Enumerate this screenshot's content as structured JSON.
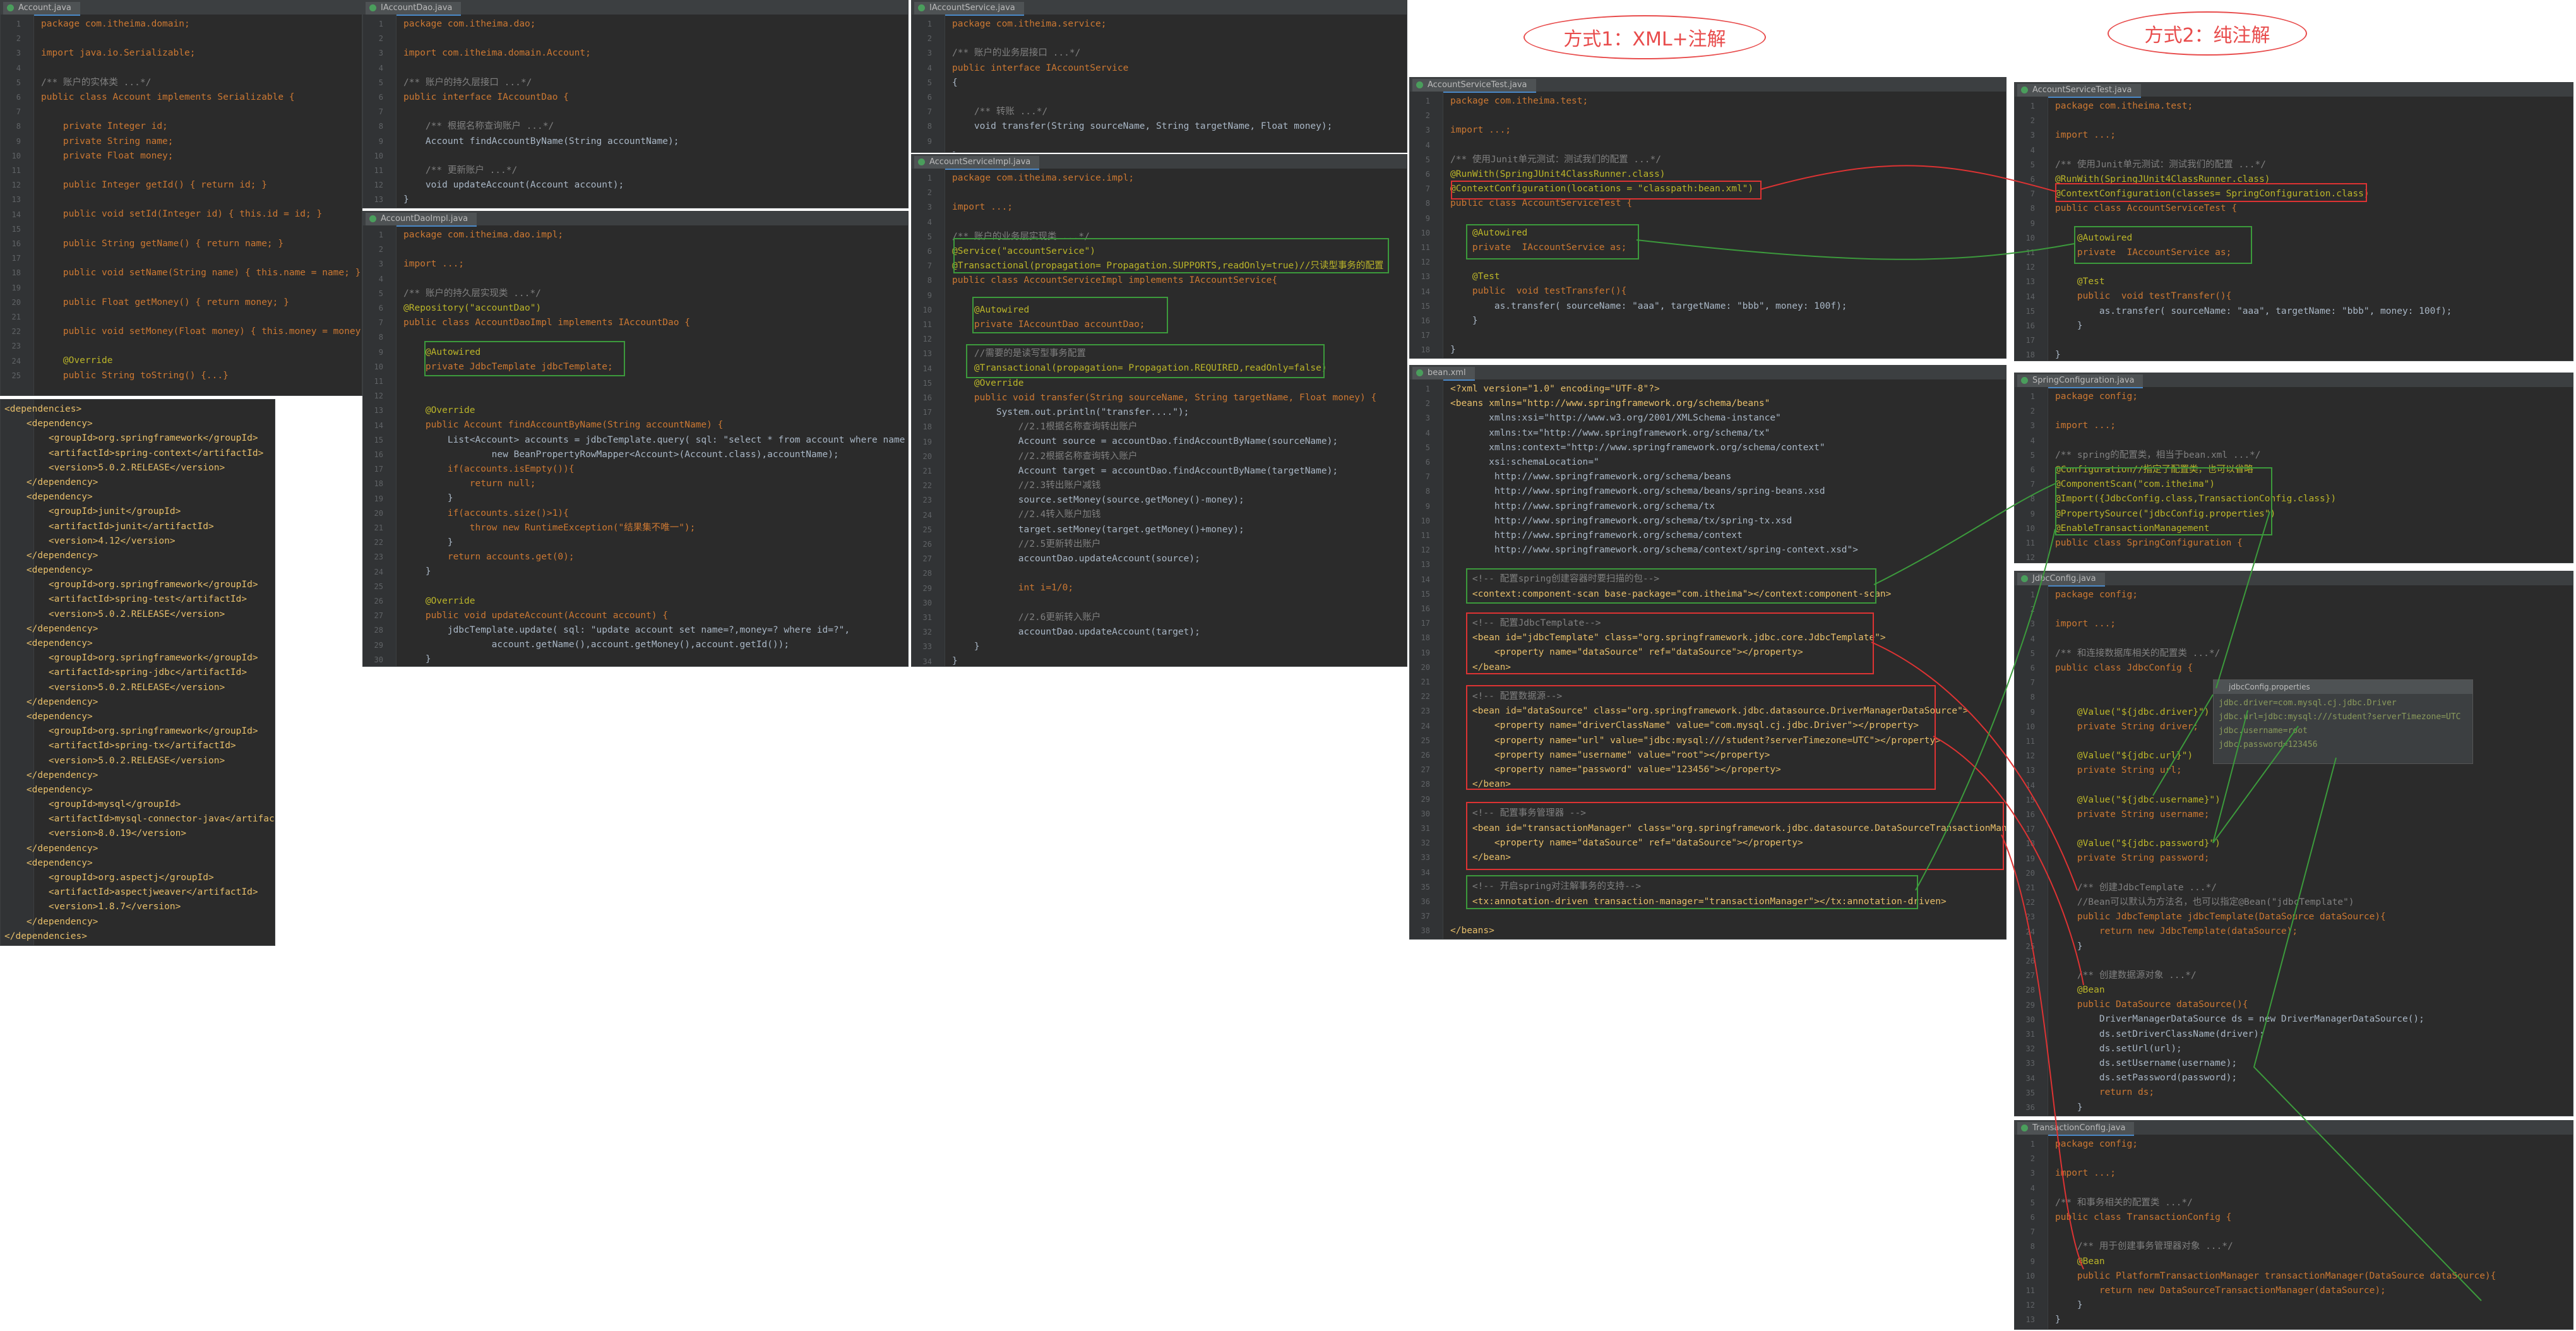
{
  "colors": {
    "editor_bg": "#2b2b2b",
    "gutter_bg": "#313335",
    "default_text": "#a9b7c6",
    "keyword": "#cc7832",
    "string": "#6a8759",
    "comment": "#808080",
    "annotation": "#bbb529",
    "number": "#6897bb",
    "field": "#9876aa",
    "method": "#ffc66d",
    "tag": "#e8bf6a",
    "callout_red": "#e84c4c",
    "box_green": "#3c9a3c"
  },
  "headings": {
    "xml_annotation": "方式1：XML+注解",
    "pure_annotation": "方式2：纯注解"
  },
  "panels": [
    {
      "id": "account",
      "file": "Account.java",
      "lines": [
        "package com.itheima.domain;",
        "",
        "import java.io.Serializable;",
        "",
        "/** 账户的实体类 ...*/",
        "public class Account implements Serializable {",
        "",
        "    private Integer id;",
        "    private String name;",
        "    private Float money;",
        "",
        "    public Integer getId() { return id; }",
        "",
        "    public void setId(Integer id) { this.id = id; }",
        "",
        "    public String getName() { return name; }",
        "",
        "    public void setName(String name) { this.name = name; }",
        "",
        "    public Float getMoney() { return money; }",
        "",
        "    public void setMoney(Float money) { this.money = money; }",
        "",
        "    @Override",
        "    public String toString() {...}"
      ]
    },
    {
      "id": "pom",
      "file": "",
      "lines": [
        "<dependencies>",
        "    <dependency>",
        "        <groupId>org.springframework</groupId>",
        "        <artifactId>spring-context</artifactId>",
        "        <version>5.0.2.RELEASE</version>",
        "    </dependency>",
        "    <dependency>",
        "        <groupId>junit</groupId>",
        "        <artifactId>junit</artifactId>",
        "        <version>4.12</version>",
        "    </dependency>",
        "    <dependency>",
        "        <groupId>org.springframework</groupId>",
        "        <artifactId>spring-test</artifactId>",
        "        <version>5.0.2.RELEASE</version>",
        "    </dependency>",
        "    <dependency>",
        "        <groupId>org.springframework</groupId>",
        "        <artifactId>spring-jdbc</artifactId>",
        "        <version>5.0.2.RELEASE</version>",
        "    </dependency>",
        "    <dependency>",
        "        <groupId>org.springframework</groupId>",
        "        <artifactId>spring-tx</artifactId>",
        "        <version>5.0.2.RELEASE</version>",
        "    </dependency>",
        "    <dependency>",
        "        <groupId>mysql</groupId>",
        "        <artifactId>mysql-connector-java</artifactId>",
        "        <version>8.0.19</version>",
        "    </dependency>",
        "    <dependency>",
        "        <groupId>org.aspectj</groupId>",
        "        <artifactId>aspectjweaver</artifactId>",
        "        <version>1.8.7</version>",
        "    </dependency>",
        "</dependencies>"
      ]
    },
    {
      "id": "iaccountdao",
      "file": "IAccountDao.java",
      "lines": [
        "package com.itheima.dao;",
        "",
        "import com.itheima.domain.Account;",
        "",
        "/** 账户的持久层接口 ...*/",
        "public interface IAccountDao {",
        "",
        "    /** 根据名称查询账户 ...*/",
        "    Account findAccountByName(String accountName);",
        "",
        "    /** 更新账户 ...*/",
        "    void updateAccount(Account account);",
        "}"
      ]
    },
    {
      "id": "accountdaoimpl",
      "file": "AccountDaoImpl.java",
      "lines": [
        "package com.itheima.dao.impl;",
        "",
        "import ...;",
        "",
        "/** 账户的持久层实现类 ...*/",
        "@Repository(\"accountDao\")",
        "public class AccountDaoImpl implements IAccountDao {",
        "",
        "    @Autowired",
        "    private JdbcTemplate jdbcTemplate;",
        "",
        "",
        "    @Override",
        "    public Account findAccountByName(String accountName) {",
        "        List<Account> accounts = jdbcTemplate.query( sql: \"select * from account where name = ?\",",
        "                new BeanPropertyRowMapper<Account>(Account.class),accountName);",
        "        if(accounts.isEmpty()){",
        "            return null;",
        "        }",
        "        if(accounts.size()>1){",
        "            throw new RuntimeException(\"结果集不唯一\");",
        "        }",
        "        return accounts.get(0);",
        "    }",
        "",
        "    @Override",
        "    public void updateAccount(Account account) {",
        "        jdbcTemplate.update( sql: \"update account set name=?,money=? where id=?\",",
        "                account.getName(),account.getMoney(),account.getId());",
        "    }",
        "}"
      ]
    },
    {
      "id": "iaccountservice",
      "file": "IAccountService.java",
      "lines": [
        "package com.itheima.service;",
        "",
        "/** 账户的业务层接口 ...*/",
        "public interface IAccountService",
        "{",
        "",
        "    /** 转账 ...*/",
        "    void transfer(String sourceName, String targetName, Float money);",
        "",
        "}"
      ]
    },
    {
      "id": "accountserviceimpl",
      "file": "AccountServiceImpl.java",
      "lines": [
        "package com.itheima.service.impl;",
        "",
        "import ...;",
        "",
        "/** 账户的业务层实现类 ...*/",
        "@Service(\"accountService\")",
        "@Transactional(propagation= Propagation.SUPPORTS,readOnly=true)//只读型事务的配置",
        "public class AccountServiceImpl implements IAccountService{",
        "",
        "    @Autowired",
        "    private IAccountDao accountDao;",
        "",
        "    //需要的是读写型事务配置",
        "    @Transactional(propagation= Propagation.REQUIRED,readOnly=false)",
        "    @Override",
        "    public void transfer(String sourceName, String targetName, Float money) {",
        "        System.out.println(\"transfer....\");",
        "            //2.1根据名称查询转出账户",
        "            Account source = accountDao.findAccountByName(sourceName);",
        "            //2.2根据名称查询转入账户",
        "            Account target = accountDao.findAccountByName(targetName);",
        "            //2.3转出账户减钱",
        "            source.setMoney(source.getMoney()-money);",
        "            //2.4转入账户加钱",
        "            target.setMoney(target.getMoney()+money);",
        "            //2.5更新转出账户",
        "            accountDao.updateAccount(source);",
        "",
        "            int i=1/0;",
        "",
        "            //2.6更新转入账户",
        "            accountDao.updateAccount(target);",
        "    }",
        "}"
      ]
    },
    {
      "id": "test_xml",
      "file": "AccountServiceTest.java",
      "lines": [
        "package com.itheima.test;",
        "",
        "import ...;",
        "",
        "/** 使用Junit单元测试：测试我们的配置 ...*/",
        "@RunWith(SpringJUnit4ClassRunner.class)",
        "@ContextConfiguration(locations = \"classpath:bean.xml\")",
        "public class AccountServiceTest {",
        "",
        "    @Autowired",
        "    private  IAccountService as;",
        "",
        "    @Test",
        "    public  void testTransfer(){",
        "        as.transfer( sourceName: \"aaa\", targetName: \"bbb\", money: 100f);",
        "    }",
        "",
        "}"
      ]
    },
    {
      "id": "beanxml",
      "file": "bean.xml",
      "lines": [
        "<?xml version=\"1.0\" encoding=\"UTF-8\"?>",
        "<beans xmlns=\"http://www.springframework.org/schema/beans\"",
        "       xmlns:xsi=\"http://www.w3.org/2001/XMLSchema-instance\"",
        "       xmlns:tx=\"http://www.springframework.org/schema/tx\"",
        "       xmlns:context=\"http://www.springframework.org/schema/context\"",
        "       xsi:schemaLocation=\"",
        "        http://www.springframework.org/schema/beans",
        "        http://www.springframework.org/schema/beans/spring-beans.xsd",
        "        http://www.springframework.org/schema/tx",
        "        http://www.springframework.org/schema/tx/spring-tx.xsd",
        "        http://www.springframework.org/schema/context",
        "        http://www.springframework.org/schema/context/spring-context.xsd\">",
        "",
        "    <!-- 配置spring创建容器时要扫描的包-->",
        "    <context:component-scan base-package=\"com.itheima\"></context:component-scan>",
        "",
        "    <!-- 配置JdbcTemplate-->",
        "    <bean id=\"jdbcTemplate\" class=\"org.springframework.jdbc.core.JdbcTemplate\">",
        "        <property name=\"dataSource\" ref=\"dataSource\"></property>",
        "    </bean>",
        "",
        "    <!-- 配置数据源-->",
        "    <bean id=\"dataSource\" class=\"org.springframework.jdbc.datasource.DriverManagerDataSource\">",
        "        <property name=\"driverClassName\" value=\"com.mysql.cj.jdbc.Driver\"></property>",
        "        <property name=\"url\" value=\"jdbc:mysql:///student?serverTimezone=UTC\"></property>",
        "        <property name=\"username\" value=\"root\"></property>",
        "        <property name=\"password\" value=\"123456\"></property>",
        "    </bean>",
        "",
        "    <!-- 配置事务管理器 -->",
        "    <bean id=\"transactionManager\" class=\"org.springframework.jdbc.datasource.DataSourceTransactionManager\">",
        "        <property name=\"dataSource\" ref=\"dataSource\"></property>",
        "    </bean>",
        "",
        "    <!-- 开启spring对注解事务的支持-->",
        "    <tx:annotation-driven transaction-manager=\"transactionManager\"></tx:annotation-driven>",
        "",
        "</beans>"
      ]
    },
    {
      "id": "test_anno",
      "file": "AccountServiceTest.java",
      "lines": [
        "package com.itheima.test;",
        "",
        "import ...;",
        "",
        "/** 使用Junit单元测试：测试我们的配置 ...*/",
        "@RunWith(SpringJUnit4ClassRunner.class)",
        "@ContextConfiguration(classes= SpringConfiguration.class)",
        "public class AccountServiceTest {",
        "",
        "    @Autowired",
        "    private  IAccountService as;",
        "",
        "    @Test",
        "    public  void testTransfer(){",
        "        as.transfer( sourceName: \"aaa\", targetName: \"bbb\", money: 100f);",
        "    }",
        "",
        "}"
      ]
    },
    {
      "id": "springconfig",
      "file": "SpringConfiguration.java",
      "lines": [
        "package config;",
        "",
        "import ...;",
        "",
        "/** spring的配置类，相当于bean.xml ...*/",
        "@Configuration//指定了配置类，也可以省略",
        "@ComponentScan(\"com.itheima\")",
        "@Import({JdbcConfig.class,TransactionConfig.class})",
        "@PropertySource(\"jdbcConfig.properties\")",
        "@EnableTransactionManagement",
        "public class SpringConfiguration {",
        "",
        "}"
      ]
    },
    {
      "id": "jdbcconfig",
      "file": "JdbcConfig.java",
      "lines": [
        "package config;",
        "",
        "import ...;",
        "",
        "/** 和连接数据库相关的配置类 ...*/",
        "public class JdbcConfig {",
        "",
        "",
        "    @Value(\"${jdbc.driver}\")",
        "    private String driver;",
        "",
        "    @Value(\"${jdbc.url}\")",
        "    private String url;",
        "",
        "    @Value(\"${jdbc.username}\")",
        "    private String username;",
        "",
        "    @Value(\"${jdbc.password}\")",
        "    private String password;",
        "",
        "    /** 创建JdbcTemplate ...*/",
        "    //Bean可以默认为方法名，也可以指定@Bean(\"jdbcTemplate\")",
        "    public JdbcTemplate jdbcTemplate(DataSource dataSource){",
        "        return new JdbcTemplate(dataSource);",
        "    }",
        "",
        "    /** 创建数据源对象 ...*/",
        "    @Bean",
        "    public DataSource dataSource(){",
        "        DriverManagerDataSource ds = new DriverManagerDataSource();",
        "        ds.setDriverClassName(driver);",
        "        ds.setUrl(url);",
        "        ds.setUsername(username);",
        "        ds.setPassword(password);",
        "        return ds;",
        "    }",
        "}"
      ]
    },
    {
      "id": "txconfig",
      "file": "TransactionConfig.java",
      "lines": [
        "package config;",
        "",
        "import ...;",
        "",
        "/** 和事务相关的配置类 ...*/",
        "public class TransactionConfig {",
        "",
        "    /** 用于创建事务管理器对象 ...*/",
        "    @Bean",
        "    public PlatformTransactionManager transactionManager(DataSource dataSource){",
        "        return new DataSourceTransactionManager(dataSource);",
        "    }",
        "}"
      ]
    }
  ],
  "properties_popup": {
    "file": "jdbcConfig.properties",
    "lines": [
      "jdbc.driver=com.mysql.cj.jdbc.Driver",
      "jdbc.url=jdbc:mysql:///student?serverTimezone=UTC",
      "jdbc.username=root",
      "jdbc.password=123456"
    ]
  }
}
